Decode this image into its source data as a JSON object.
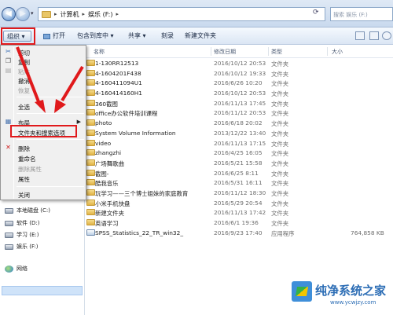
{
  "address": {
    "crumbs": [
      "计算机",
      "娱乐 (F:)"
    ],
    "search_placeholder": "搜索 娱乐 (F:)"
  },
  "toolbar": {
    "organize": "组织 ▾",
    "open": "打开",
    "include_in_library": "包含到库中 ▾",
    "share": "共享 ▾",
    "burn": "刻录",
    "new_folder": "新建文件夹"
  },
  "columns": {
    "name": "名称",
    "date": "修改日期",
    "type": "类型",
    "size": "大小"
  },
  "files": [
    {
      "name": "1-130RR12513",
      "date": "2016/10/12 20:53",
      "type": "文件夹",
      "size": ""
    },
    {
      "name": "4-1604201F438",
      "date": "2016/10/12 19:33",
      "type": "文件夹",
      "size": ""
    },
    {
      "name": "4-160411094U1",
      "date": "2016/6/26 10:20",
      "type": "文件夹",
      "size": ""
    },
    {
      "name": "4-160414160H1",
      "date": "2016/10/12 20:53",
      "type": "文件夹",
      "size": ""
    },
    {
      "name": "360截图",
      "date": "2016/11/13 17:45",
      "type": "文件夹",
      "size": ""
    },
    {
      "name": "office办公软件培训课程",
      "date": "2016/11/12 20:53",
      "type": "文件夹",
      "size": ""
    },
    {
      "name": "photo",
      "date": "2016/6/18 20:02",
      "type": "文件夹",
      "size": ""
    },
    {
      "name": "System Volume Information",
      "date": "2013/12/22 13:40",
      "type": "文件夹",
      "size": ""
    },
    {
      "name": "video",
      "date": "2016/11/13 17:15",
      "type": "文件夹",
      "size": ""
    },
    {
      "name": "zhangzhi",
      "date": "2016/4/25 16:05",
      "type": "文件夹",
      "size": ""
    },
    {
      "name": "广场舞歌曲",
      "date": "2016/5/21 15:58",
      "type": "文件夹",
      "size": ""
    },
    {
      "name": "截图-",
      "date": "2016/6/25 8:11",
      "type": "文件夹",
      "size": ""
    },
    {
      "name": "酷我音乐",
      "date": "2016/5/31 16:11",
      "type": "文件夹",
      "size": ""
    },
    {
      "name": "玩学习——三个博士姐妹的家庭教育",
      "date": "2016/11/12 18:30",
      "type": "文件夹",
      "size": ""
    },
    {
      "name": "小米手机快盘",
      "date": "2016/5/29 20:54",
      "type": "文件夹",
      "size": ""
    },
    {
      "name": "新建文件夹",
      "date": "2016/11/13 17:42",
      "type": "文件夹",
      "size": ""
    },
    {
      "name": "英语学习",
      "date": "2016/6/1 19:36",
      "type": "文件夹",
      "size": ""
    },
    {
      "name": "SPSS_Statistics_22_TR_win32_",
      "date": "2016/9/23 17:40",
      "type": "应用程序",
      "size": "764,858 KB",
      "icon": "application"
    }
  ],
  "menu": {
    "cut": "剪切",
    "copy": "复制",
    "paste": "粘贴",
    "undo": "撤消",
    "redo": "恢复",
    "select_all": "全选",
    "layout": "布局",
    "folder_options": "文件夹和搜索选项",
    "delete": "删除",
    "rename": "重命名",
    "remove_properties": "删除属性",
    "properties": "属性",
    "close": "关闭"
  },
  "navpane": {
    "drives": [
      "本地磁盘 (C:)",
      "软件 (D:)",
      "学习 (E:)",
      "娱乐 (F:)"
    ],
    "network": "网络"
  },
  "annotation_color": "#e0191b",
  "watermark": {
    "title": "纯净系统之家",
    "url": "www.ycwjzy.com"
  }
}
